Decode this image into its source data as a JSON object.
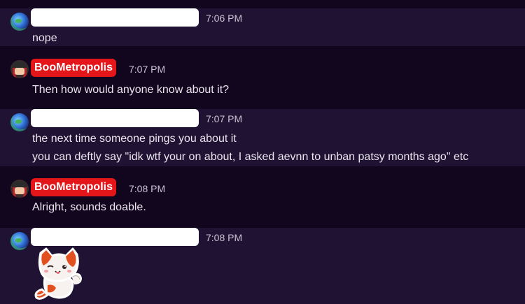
{
  "messages": [
    {
      "time": "7:06 PM",
      "lines": [
        "nope"
      ]
    },
    {
      "author": "BooMetropolis",
      "time": "7:07 PM",
      "lines": [
        "Then how would anyone know about it?"
      ]
    },
    {
      "time": "7:07 PM",
      "lines": [
        "the next time someone pings you about it",
        "you can deftly say \"idk wtf your on about, I asked aevnn to unban patsy months ago\" etc"
      ]
    },
    {
      "author": "BooMetropolis",
      "time": "7:08 PM",
      "lines": [
        "Alright, sounds doable."
      ]
    },
    {
      "time": "7:08 PM",
      "sticker": "cat-sticker"
    }
  ],
  "colors": {
    "author_badge": "#e5161a",
    "highlight_bg": "#1f1232",
    "background": "#12061f"
  }
}
